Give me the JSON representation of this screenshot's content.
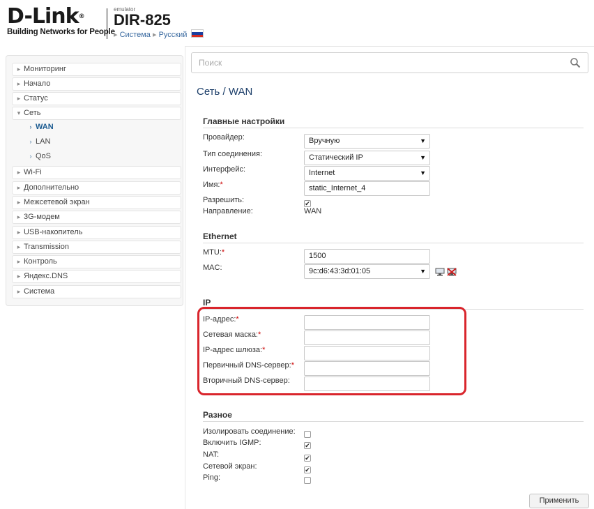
{
  "header": {
    "logo_text": "D-Link",
    "logo_reg": "®",
    "logo_tagline": "Building Networks for People",
    "emulator_label": "emulator",
    "model": "DIR-825",
    "crumb_system": "Система",
    "crumb_language": "Русский",
    "flag_colors": [
      "#ffffff",
      "#1c3f9e",
      "#d52b1e"
    ]
  },
  "sidebar": {
    "items": [
      {
        "label": "Мониторинг",
        "bullet": "▸"
      },
      {
        "label": "Начало",
        "bullet": "▸"
      },
      {
        "label": "Статус",
        "bullet": "▸"
      },
      {
        "label": "Сеть",
        "bullet": "▾"
      },
      {
        "label": "WAN",
        "bullet": "›"
      },
      {
        "label": "LAN",
        "bullet": "›"
      },
      {
        "label": "QoS",
        "bullet": "›"
      },
      {
        "label": "Wi-Fi",
        "bullet": "▸"
      },
      {
        "label": "Дополнительно",
        "bullet": "▸"
      },
      {
        "label": "Межсетевой экран",
        "bullet": "▸"
      },
      {
        "label": "3G-модем",
        "bullet": "▸"
      },
      {
        "label": "USB-накопитель",
        "bullet": "▸"
      },
      {
        "label": "Transmission",
        "bullet": "▸"
      },
      {
        "label": "Контроль",
        "bullet": "▸"
      },
      {
        "label": "Яндекс.DNS",
        "bullet": "▸"
      },
      {
        "label": "Система",
        "bullet": "▸"
      }
    ]
  },
  "search": {
    "placeholder": "Поиск",
    "icon": "magnifier-icon"
  },
  "page_title": "Сеть /  WAN",
  "main_settings": {
    "title": "Главные настройки",
    "provider_label": "Провайдер:",
    "provider_value": "Вручную",
    "conn_type_label": "Тип соединения:",
    "conn_type_value": "Статический IP",
    "interface_label": "Интерфейс:",
    "interface_value": "Internet",
    "name_label": "Имя:",
    "name_value": "static_Internet_4",
    "enable_label": "Разрешить:",
    "enable_checked": true,
    "direction_label": "Направление:",
    "direction_value": "WAN"
  },
  "ethernet": {
    "title": "Ethernet",
    "mtu_label": "MTU:",
    "mtu_value": "1500",
    "mac_label": "MAC:",
    "mac_value": "9c:d6:43:3d:01:05"
  },
  "ip": {
    "title": "IP",
    "ip_label": "IP-адрес:",
    "mask_label": "Сетевая маска:",
    "gateway_label": "IP-адрес шлюза:",
    "dns1_label": "Первичный DNS-сервер:",
    "dns2_label": "Вторичный DNS-сервер:",
    "highlight_color": "#d9252c"
  },
  "misc": {
    "title": "Разное",
    "isolate_label": "Изолировать соединение:",
    "isolate_checked": false,
    "igmp_label": "Включить IGMP:",
    "igmp_checked": true,
    "nat_label": "NAT:",
    "nat_checked": true,
    "firewall_label": "Сетевой экран:",
    "firewall_checked": true,
    "ping_label": "Ping:",
    "ping_checked": false
  },
  "required_mark": "*",
  "apply_label": "Применить"
}
